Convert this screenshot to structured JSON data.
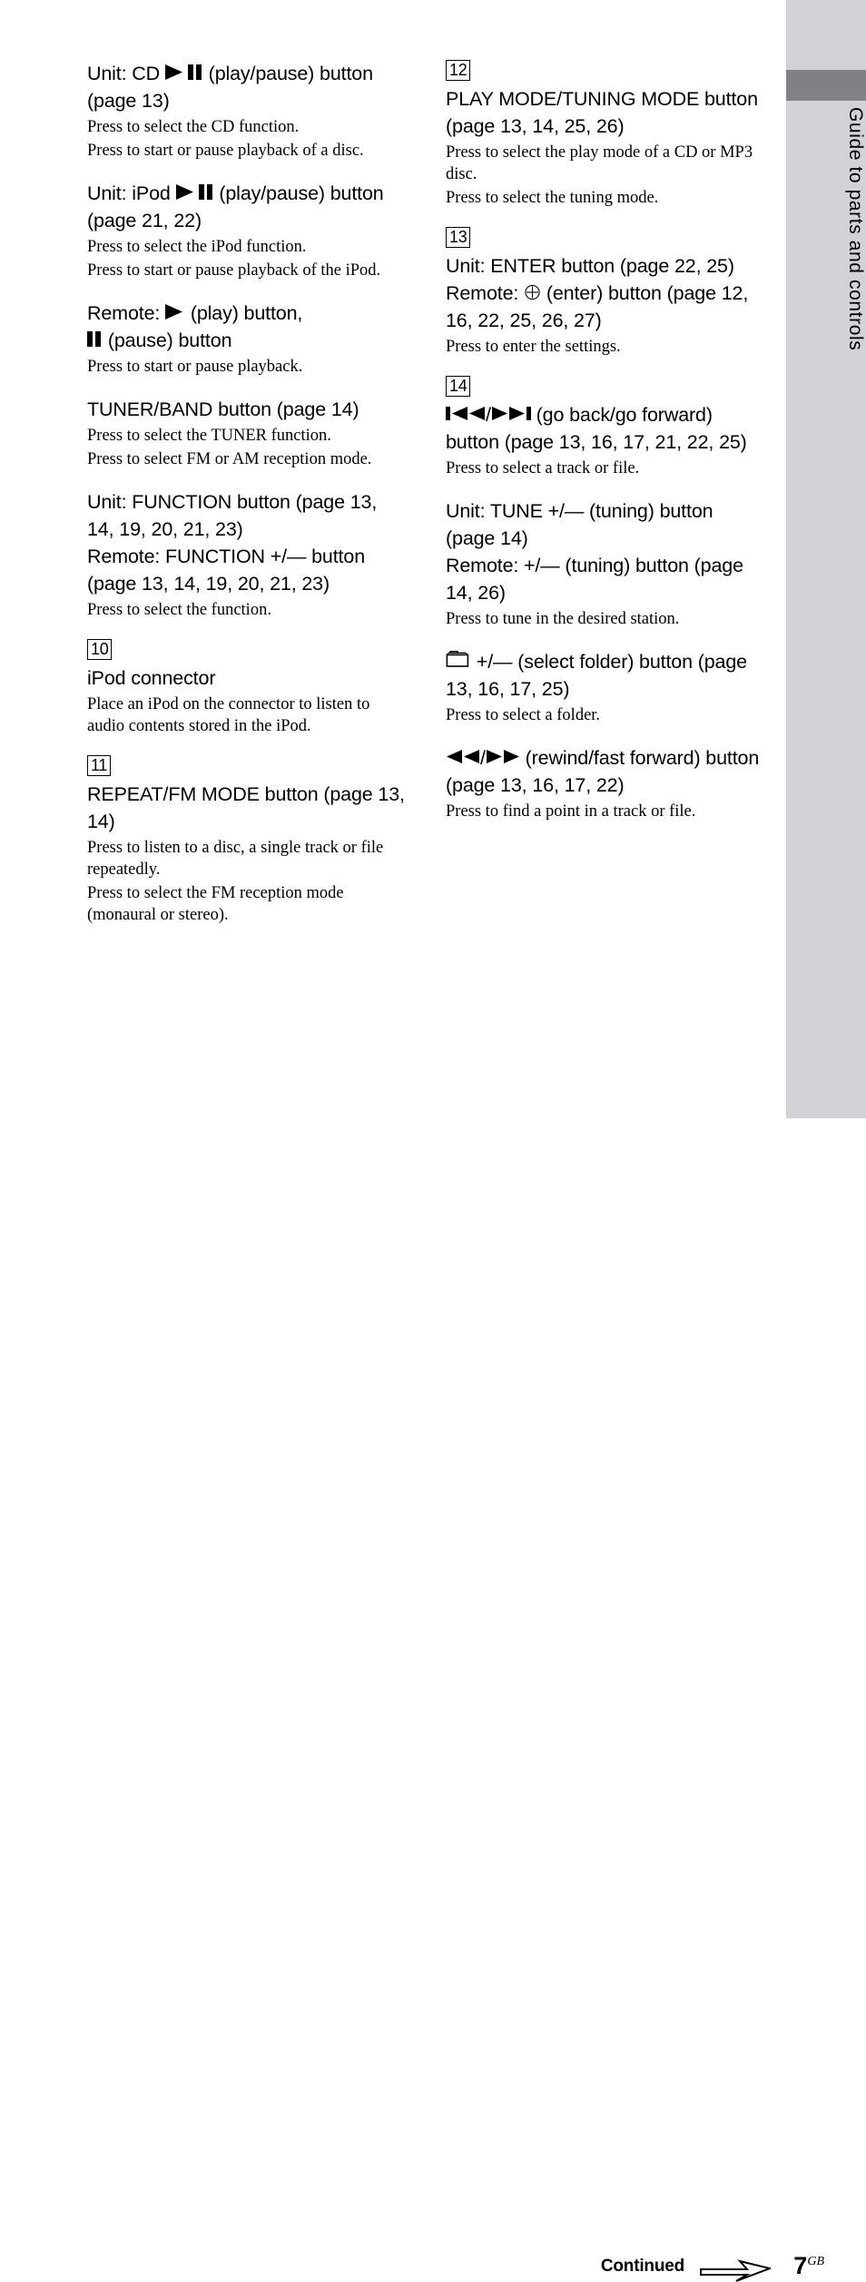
{
  "sidebar": {
    "chapter_label": "Guide to parts and controls",
    "band_color": "#808285",
    "background_color": "#d2d3d5"
  },
  "footer": {
    "continued_label": "Continued",
    "arrow_icon": "continued-arrow-icon",
    "page_number": "7",
    "page_suffix": "GB"
  },
  "columns": {
    "left": [
      {
        "number": null,
        "headings": [
          "Unit: CD ▶❙❙ (play/pause)",
          "button (page 13)"
        ],
        "heading_parts": {
          "pre": "Unit: CD ",
          "icon": "play-pause-icon",
          "post": " (play/pause) button (page 13)"
        },
        "body": [
          "Press to select the CD function.",
          "Press to start or pause playback of a disc."
        ]
      },
      {
        "number": null,
        "heading_parts": {
          "pre": "Unit: iPod ",
          "icon": "play-pause-icon",
          "post": " (play/pause) button (page 21, 22)"
        },
        "body": [
          "Press to select the iPod function.",
          "Press to start or pause playback of the iPod."
        ]
      },
      {
        "number": null,
        "heading_parts": {
          "pre": "Remote: ",
          "icon": "play-icon",
          "mid": " (play) button,",
          "icon2": "pause-icon",
          "post": " (pause) button"
        },
        "body": [
          "Press to start or pause playback."
        ]
      },
      {
        "number": null,
        "heading_parts": {
          "pre": "",
          "post": "TUNER/BAND button (page 14)"
        },
        "body": [
          "Press to select the TUNER function.",
          "Press to select FM or AM reception mode."
        ]
      },
      {
        "number": null,
        "heading_parts": {
          "pre": "",
          "post": "Unit: FUNCTION button (page 13, 14, 19, 20, 21, 23)"
        },
        "heading2": "Remote: FUNCTION +/— button (page 13, 14, 19, 20, 21, 23)",
        "body": [
          "Press to select the function."
        ]
      },
      {
        "number": "10",
        "heading_parts": {
          "pre": "",
          "post": "iPod connector"
        },
        "body": [
          "Place an iPod on the connector to listen to audio contents stored in the iPod."
        ]
      },
      {
        "number": "11",
        "heading_parts": {
          "pre": "",
          "post": "REPEAT/FM MODE button (page 13, 14)"
        },
        "body": [
          "Press to listen to a disc, a single track or file repeatedly.",
          "Press to select the FM reception mode (monaural or stereo)."
        ]
      }
    ],
    "right": [
      {
        "number": "12",
        "heading_parts": {
          "pre": "",
          "post": "PLAY MODE/TUNING MODE button (page 13, 14, 25, 26)"
        },
        "body": [
          "Press to select the play mode of a CD or MP3 disc.",
          "Press to select the tuning mode."
        ]
      },
      {
        "number": "13",
        "heading_parts": {
          "pre": "",
          "post": "Unit: ENTER button (page 22, 25)"
        },
        "heading2_parts": {
          "pre": "Remote: ",
          "icon": "enter-circle-icon",
          "post": " (enter) button (page 12, 16, 22, 25, 26, 27)"
        },
        "body": [
          "Press to enter the settings."
        ]
      },
      {
        "number": "14",
        "heading_parts": {
          "icon": "go-back-icon",
          "sep": "/",
          "icon2": "go-forward-icon",
          "post": " (go back/go forward) button (page 13, 16, 17, 21, 22, 25)"
        },
        "body": [
          "Press to select a track or file."
        ]
      },
      {
        "number": null,
        "heading_parts": {
          "pre": "",
          "post": "Unit: TUNE +/— (tuning) button (page 14)"
        },
        "heading2": "Remote: +/— (tuning) button (page 14, 26)",
        "body": [
          "Press to tune in the desired station."
        ]
      },
      {
        "number": null,
        "heading_parts": {
          "icon": "folder-icon",
          "post": " +/— (select folder) button (page 13, 16, 17, 25)"
        },
        "body": [
          "Press to select a folder."
        ]
      },
      {
        "number": null,
        "heading_parts": {
          "icon": "rewind-icon",
          "sep": "/",
          "icon2": "fast-forward-icon",
          "post": " (rewind/fast forward) button (page 13, 16, 17, 22)"
        },
        "body": [
          "Press to find a point in a track or file."
        ]
      }
    ]
  },
  "text": {
    "l0_h_pre": "Unit: CD ",
    "l0_h_post": " (play/pause) button (page 13)",
    "l0_b0": "Press to select the CD function.",
    "l0_b1": "Press to start or pause playback of a disc.",
    "l1_h_pre": "Unit: iPod ",
    "l1_h_post": " (play/pause) button (page 21, 22)",
    "l1_b0": "Press to select the iPod function.",
    "l1_b1": "Press to start or pause playback of the iPod.",
    "l2_h_pre": "Remote: ",
    "l2_h_mid": " (play) button,",
    "l2_h_post": " (pause) button",
    "l2_b0": "Press to start or pause playback.",
    "l3_h": "TUNER/BAND button (page 14)",
    "l3_b0": "Press to select the TUNER function.",
    "l3_b1": "Press to select FM or AM reception mode.",
    "l4_h": "Unit: FUNCTION button (page 13, 14, 19, 20, 21, 23)",
    "l4_h2": "Remote: FUNCTION +/— button (page 13, 14, 19, 20, 21, 23)",
    "l4_b0": "Press to select the function.",
    "l5_num": "10",
    "l5_h": "iPod connector",
    "l5_b0": "Place an iPod on the connector to listen to audio contents stored in the iPod.",
    "l6_num": "11",
    "l6_h": "REPEAT/FM MODE button (page 13, 14)",
    "l6_b0": "Press to listen to a disc, a single track or file repeatedly.",
    "l6_b1": "Press to select the FM reception mode (monaural or stereo).",
    "r0_num": "12",
    "r0_h": "PLAY MODE/TUNING MODE button (page 13, 14, 25, 26)",
    "r0_b0": "Press to select the play mode of a CD or MP3 disc.",
    "r0_b1": "Press to select the tuning mode.",
    "r1_num": "13",
    "r1_h": "Unit: ENTER button (page 22, 25)",
    "r1_h2_pre": "Remote: ",
    "r1_h2_post": " (enter) button (page 12, 16, 22, 25, 26, 27)",
    "r1_b0": "Press to enter the settings.",
    "r2_num": "14",
    "r2_h_sep": "/",
    "r2_h_post": " (go back/go forward) button (page 13, 16, 17, 21, 22, 25)",
    "r2_b0": "Press to select a track or file.",
    "r3_h": "Unit: TUNE +/— (tuning) button (page 14)",
    "r3_h2": "Remote: +/— (tuning) button (page 14, 26)",
    "r3_b0": "Press to tune in the desired station.",
    "r4_h_post": " +/— (select folder) button (page 13, 16, 17, 25)",
    "r4_b0": "Press to select a folder.",
    "r5_h_sep": "/",
    "r5_h_post": " (rewind/fast forward) button (page 13, 16, 17, 22)",
    "r5_b0": "Press to find a point in a track or file."
  }
}
